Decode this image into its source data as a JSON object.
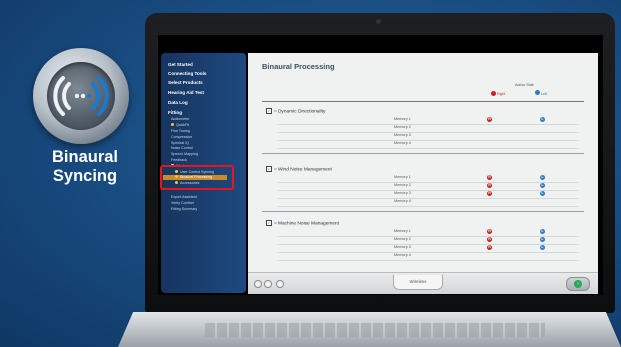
{
  "promo": {
    "title_line1": "Binaural",
    "title_line2": "Syncing"
  },
  "sidebar": {
    "items": [
      {
        "label": "Get Started"
      },
      {
        "label": "Connecting Tools"
      },
      {
        "label": "Select Products"
      },
      {
        "label": "Hearing Aid Test"
      },
      {
        "label": "Data Log"
      },
      {
        "label": "Fitting"
      }
    ],
    "fitting_subitems": [
      {
        "label": "Audiometer"
      },
      {
        "label": "QuickFit"
      },
      {
        "label": "Fine Tuning"
      },
      {
        "label": "Compression"
      },
      {
        "label": "Spectral IQ"
      },
      {
        "label": "Noise Control"
      },
      {
        "label": "Speech Mapping"
      },
      {
        "label": "Feedback"
      },
      {
        "label": "Wireless"
      },
      {
        "label": "User Control Syncing"
      },
      {
        "label": "Binaural Processing"
      },
      {
        "label": "Accessories"
      },
      {
        "label": "Expert Assistant"
      },
      {
        "label": "Verify Comfort"
      },
      {
        "label": "Fitting Summary"
      }
    ]
  },
  "main": {
    "title": "Binaural Processing",
    "active_side_label": "Active Side",
    "right_label": "Right",
    "left_label": "Left",
    "sections": [
      {
        "title": "Dynamic Directionality",
        "icon": "microphone-icon",
        "rows": [
          {
            "memory": "Memory 1",
            "right": true,
            "left": true
          },
          {
            "memory": "Memory 2",
            "right": false,
            "left": false
          },
          {
            "memory": "Memory 3",
            "right": false,
            "left": false
          },
          {
            "memory": "Memory 4",
            "right": false,
            "left": false
          }
        ]
      },
      {
        "title": "Wind Noise Management",
        "icon": "wind-icon",
        "rows": [
          {
            "memory": "Memory 1",
            "right": true,
            "left": true
          },
          {
            "memory": "Memory 2",
            "right": true,
            "left": true
          },
          {
            "memory": "Memory 3",
            "right": true,
            "left": true
          },
          {
            "memory": "Memory 4",
            "right": false,
            "left": false
          }
        ]
      },
      {
        "title": "Machine Noise Management",
        "icon": "machine-icon",
        "rows": [
          {
            "memory": "Memory 1",
            "right": true,
            "left": true
          },
          {
            "memory": "Memory 2",
            "right": true,
            "left": true
          },
          {
            "memory": "Memory 3",
            "right": true,
            "left": true
          },
          {
            "memory": "Memory 4",
            "right": false,
            "left": false
          }
        ]
      }
    ],
    "marks": {
      "right_glyph": "R",
      "left_glyph": "L"
    }
  },
  "bottombar": {
    "tab_label": "Wireless",
    "next_glyph": "›"
  },
  "colors": {
    "highlight": "#e8161b",
    "right_mark": "#c8221f",
    "left_mark": "#2e7cc4",
    "background": "#1a4f85"
  }
}
